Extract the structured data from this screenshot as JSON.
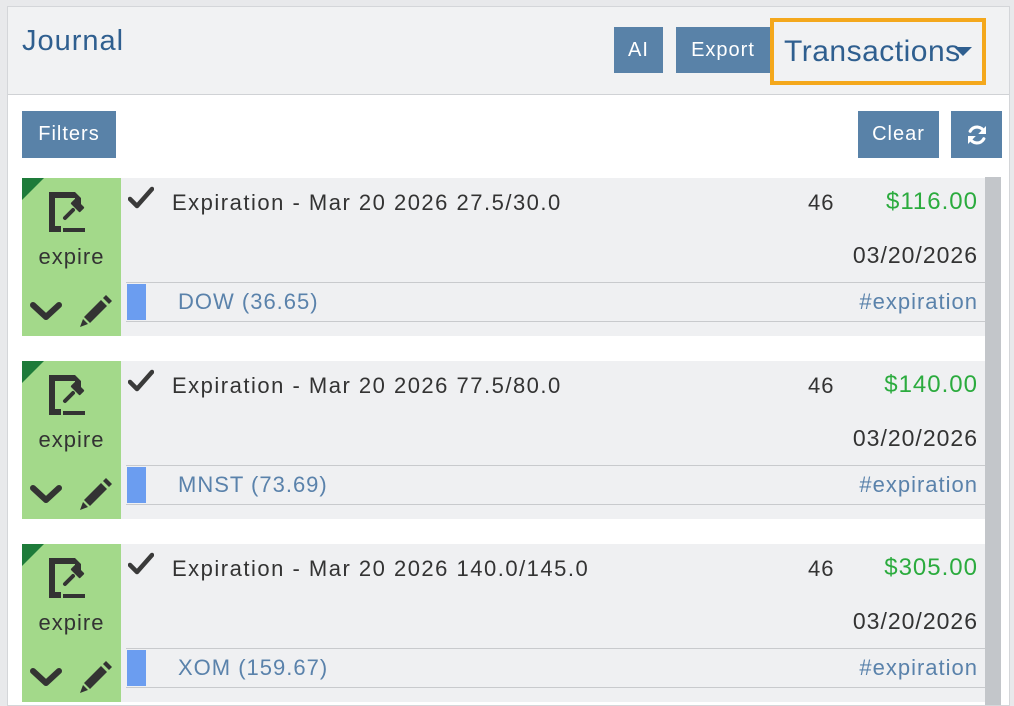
{
  "header": {
    "title": "Journal",
    "ai_label": "AI",
    "export_label": "Export",
    "view_selector": "Transactions"
  },
  "toolbar": {
    "filters_label": "Filters",
    "clear_label": "Clear"
  },
  "icons": {
    "document": "document-gavel-icon",
    "expand": "chevron-down-icon",
    "edit": "pencil-icon",
    "status": "checkmark-icon",
    "refresh": "refresh-icon"
  },
  "colors": {
    "button": "#5982a8",
    "highlight_border": "#f4a81c",
    "badge": "#a3d98a",
    "badge_corner": "#1e7b3a",
    "amount": "#2bab3e",
    "symbol_bar": "#6b9df0",
    "link": "#5a82ab"
  },
  "transactions": [
    {
      "type": "expire",
      "description": "Expiration - Mar 20 2026 27.5/30.0",
      "quantity": "46",
      "amount": "$116.00",
      "date": "03/20/2026",
      "symbol": "DOW (36.65)",
      "tag": "#expiration"
    },
    {
      "type": "expire",
      "description": "Expiration - Mar 20 2026 77.5/80.0",
      "quantity": "46",
      "amount": "$140.00",
      "date": "03/20/2026",
      "symbol": "MNST (73.69)",
      "tag": "#expiration"
    },
    {
      "type": "expire",
      "description": "Expiration - Mar 20 2026 140.0/145.0",
      "quantity": "46",
      "amount": "$305.00",
      "date": "03/20/2026",
      "symbol": "XOM (159.67)",
      "tag": "#expiration"
    }
  ]
}
